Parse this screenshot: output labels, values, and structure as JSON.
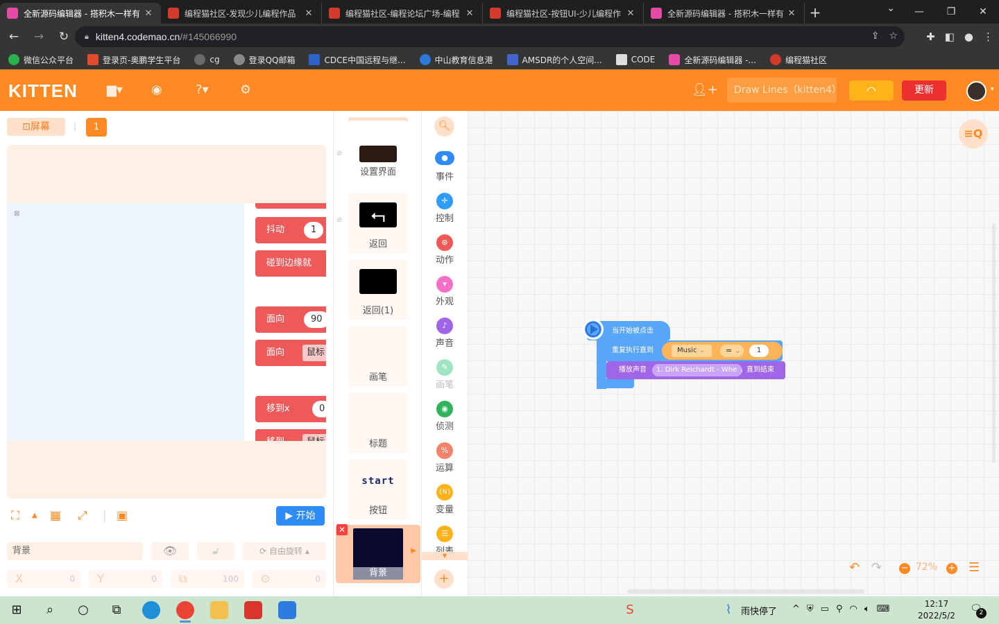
{
  "browser": {
    "tabs": [
      {
        "title": "全新源码编辑器 - 搭积木一样有",
        "color": "#e44ba6",
        "active": true
      },
      {
        "title": "编程猫社区-发现少儿编程作品",
        "color": "#d33a2c",
        "active": false
      },
      {
        "title": "编程猫社区-编程论坛广场-编程",
        "color": "#d33a2c",
        "active": false
      },
      {
        "title": "编程猫社区-按钮UI-少儿编程作",
        "color": "#d33a2c",
        "active": false
      },
      {
        "title": "全新源码编辑器 - 搭积木一样有",
        "color": "#e44ba6",
        "active": false
      }
    ],
    "url_host": "kitten4.codemao.cn",
    "url_path": "/#145066990",
    "bookmarks": [
      {
        "label": "微信公众平台",
        "color": "#2bb24c"
      },
      {
        "label": "登录页-奥鹏学生平台",
        "color": "#e34b2e"
      },
      {
        "label": "cg",
        "color": "#6a6a6a"
      },
      {
        "label": "登录QQ邮箱",
        "color": "#8a8a8a"
      },
      {
        "label": "CDCE中国远程与继...",
        "color": "#2c62c9"
      },
      {
        "label": "中山教育信息港",
        "color": "#2c7ad6"
      },
      {
        "label": "AMSDR的个人空间...",
        "color": "#4466cc"
      },
      {
        "label": "CODE",
        "color": "#dddddd"
      },
      {
        "label": "全新源码编辑器 -...",
        "color": "#e44ba6"
      },
      {
        "label": "编程猫社区",
        "color": "#d33a2c"
      }
    ]
  },
  "app": {
    "logo": "KITTEN",
    "project_name": "Draw Lines（kitten4）",
    "update_label": "更新"
  },
  "stage": {
    "screen_label": "屏幕",
    "screen_number": "1",
    "blocks": [
      {
        "label": "抖动",
        "value": "1"
      },
      {
        "label": "碰到边缘就",
        "value": ""
      },
      {
        "label": "面向",
        "value": "90"
      },
      {
        "label": "面向",
        "value": "鼠标"
      },
      {
        "label": "移到x",
        "value": "0"
      },
      {
        "label": "移到",
        "value": "鼠标"
      }
    ],
    "start_label": "开始",
    "bg_label": "背景",
    "rotate_label": "自由旋转",
    "x_label": "X",
    "x_value": "0",
    "y_label": "Y",
    "y_value": "0",
    "size_value": "100",
    "dir_value": "0"
  },
  "sprites": {
    "items": [
      {
        "name": "设置界面"
      },
      {
        "name": "返回"
      },
      {
        "name": "返回(1)"
      },
      {
        "name": "画笔"
      },
      {
        "name": "标题"
      },
      {
        "name": "按钮",
        "thumb_text": "start"
      }
    ],
    "background_name": "背景"
  },
  "categories": [
    {
      "label": "事件",
      "color": "#2f8cf7",
      "dim": false
    },
    {
      "label": "控制",
      "color": "#2f9cf7",
      "dim": false
    },
    {
      "label": "动作",
      "color": "#ee5a5a",
      "dim": false
    },
    {
      "label": "外观",
      "color": "#f46fc7",
      "dim": false
    },
    {
      "label": "声音",
      "color": "#a066e8",
      "dim": false
    },
    {
      "label": "画笔",
      "color": "#6fd7a3",
      "dim": true
    },
    {
      "label": "侦测",
      "color": "#2fb45a",
      "dim": false
    },
    {
      "label": "运算",
      "color": "#f2836a",
      "dim": false
    },
    {
      "label": "变量",
      "color": "#ffb21a",
      "dim": false
    },
    {
      "label": "列表",
      "color": "#ffb21a",
      "dim": false
    }
  ],
  "workspace": {
    "hat_label": "当开始被点击",
    "loop_label": "重复执行直到",
    "cond_var": "Music",
    "cond_op": "=",
    "cond_value": "1",
    "sound_label": "播放声音",
    "sound_name": "1. Dirk Reichardt - Whe",
    "sound_tail": "直到结束",
    "zoom": "72%"
  },
  "taskbar": {
    "weather": "雨快停了",
    "time": "12:17",
    "date": "2022/5/2",
    "notifications": "2"
  }
}
